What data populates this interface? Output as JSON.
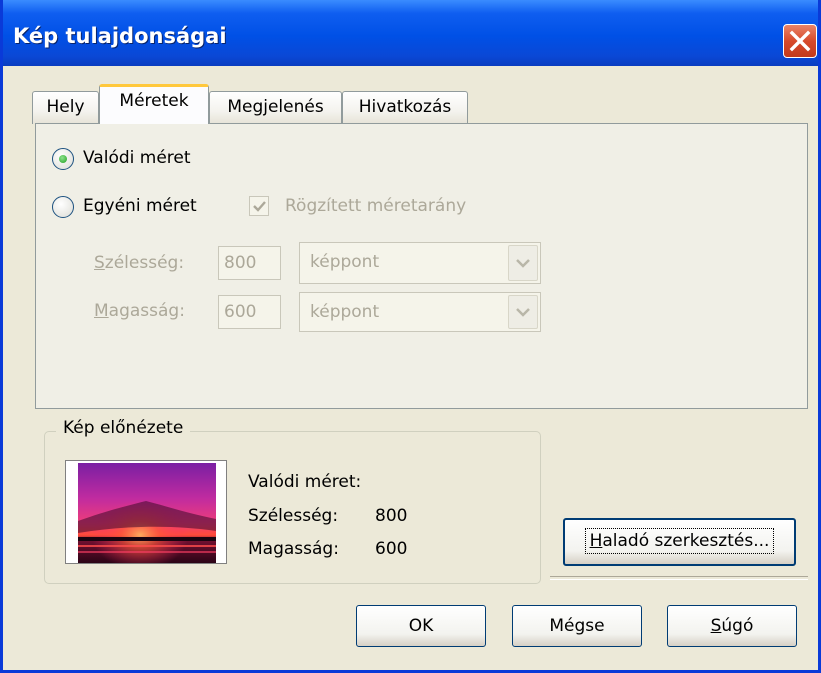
{
  "dialog": {
    "title": "Kép tulajdonságai"
  },
  "tabs": [
    {
      "label": "Hely",
      "active": false
    },
    {
      "label": "Méretek",
      "active": true
    },
    {
      "label": "Megjelenés",
      "active": false
    },
    {
      "label": "Hivatkozás",
      "active": false
    }
  ],
  "size_options": {
    "actual_size_label": "Valódi méret",
    "actual_size_checked": true,
    "custom_size_label": "Egyéni méret",
    "custom_size_checked": false,
    "keep_ratio_label": "Rögzített méretarány",
    "keep_ratio_checked": true,
    "keep_ratio_enabled": false
  },
  "width_row": {
    "label_accel": "S",
    "label_rest": "zélesség:",
    "value": "800",
    "unit": "képpont",
    "enabled": false
  },
  "height_row": {
    "label_accel": "M",
    "label_rest": "agasság:",
    "value": "600",
    "unit": "képpont",
    "enabled": false
  },
  "preview": {
    "legend": "Kép előnézete",
    "actual_size_label": "Valódi méret:",
    "width_label": "Szélesség:",
    "width_value": "800",
    "height_label": "Magasság:",
    "height_value": "600"
  },
  "buttons": {
    "advanced_accel": "H",
    "advanced_rest": "aladó szerkesztés...",
    "ok": "OK",
    "cancel": "Mégse",
    "help_accel": "S",
    "help_rest": "úgó"
  },
  "colors": {
    "titlebar": "#0050e6",
    "close": "#d74a2b",
    "radio_dot": "#21a121",
    "active_tab_accent": "#ffc83c"
  }
}
